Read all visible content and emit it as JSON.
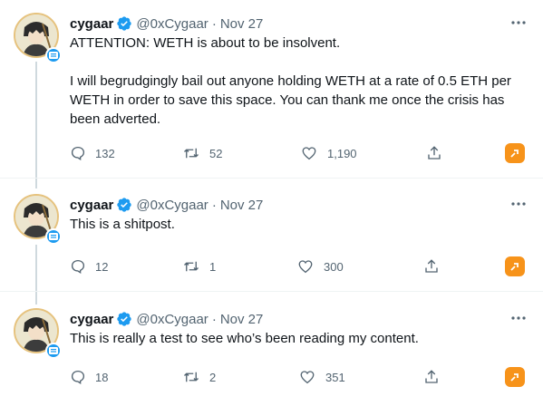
{
  "tweets": [
    {
      "name": "cygaar",
      "handle": "@0xCygaar",
      "separator": "·",
      "time": "Nov 27",
      "paragraphs": [
        "ATTENTION: WETH is about to be insolvent.",
        "I will begrudgingly bail out anyone holding WETH at a rate of 0.5 ETH per WETH in order to save this space. You can thank me once the crisis has been adverted."
      ],
      "replies": "132",
      "retweets": "52",
      "likes": "1,190"
    },
    {
      "name": "cygaar",
      "handle": "@0xCygaar",
      "separator": "·",
      "time": "Nov 27",
      "paragraphs": [
        "This is a shitpost."
      ],
      "replies": "12",
      "retweets": "1",
      "likes": "300"
    },
    {
      "name": "cygaar",
      "handle": "@0xCygaar",
      "separator": "·",
      "time": "Nov 27",
      "paragraphs": [
        "This is really a test to see who’s been reading my content."
      ],
      "replies": "18",
      "retweets": "2",
      "likes": "351"
    }
  ],
  "icons": {
    "verified": "verified-badge-icon",
    "more": "more-icon",
    "reply": "reply-icon",
    "retweet": "retweet-icon",
    "like": "heart-icon",
    "share": "share-icon",
    "extension": "extension-icon"
  },
  "colors": {
    "verified": "#1d9bf0",
    "secondary_text": "#536471",
    "extension": "#f7931a",
    "avatar_ring": "#e6c27d"
  }
}
